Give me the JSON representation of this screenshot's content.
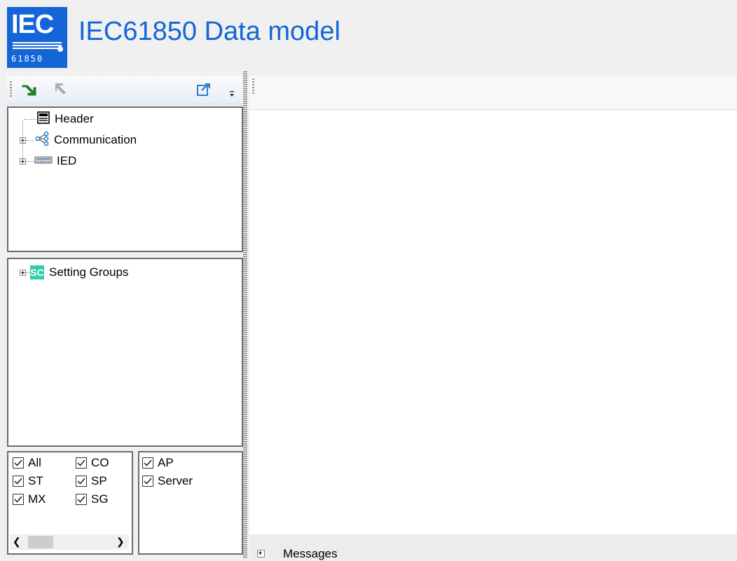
{
  "app": {
    "logo_text": "IEC",
    "logo_number": "61850",
    "title": "IEC61850 Data model"
  },
  "left_toolbar": {
    "icons": [
      "import-arrow-icon",
      "export-arrow-icon",
      "share-icon",
      "overflow-chevron-icon"
    ]
  },
  "tree": {
    "items": [
      {
        "label": "Header",
        "icon": "document-icon",
        "expandable": false
      },
      {
        "label": "Communication",
        "icon": "network-icon",
        "expandable": true
      },
      {
        "label": "IED",
        "icon": "device-icon",
        "expandable": true
      }
    ]
  },
  "settings_tree": {
    "items": [
      {
        "label": "Setting Groups",
        "icon_text": "SC",
        "expandable": true
      }
    ]
  },
  "filters": {
    "fc": [
      {
        "label": "All",
        "checked": true
      },
      {
        "label": "CO",
        "checked": true
      },
      {
        "label": "ST",
        "checked": true
      },
      {
        "label": "SP",
        "checked": true
      },
      {
        "label": "MX",
        "checked": true
      },
      {
        "label": "SG",
        "checked": true
      }
    ],
    "scope": [
      {
        "label": "AP",
        "checked": true
      },
      {
        "label": "Server",
        "checked": true
      }
    ]
  },
  "messages": {
    "label": "Messages"
  },
  "colors": {
    "brand": "#1565d8",
    "sc_badge": "#2ecfa6"
  }
}
